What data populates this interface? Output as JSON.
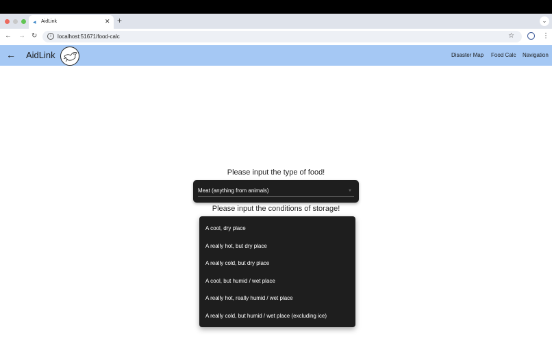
{
  "browser": {
    "tab_title": "AidLink",
    "tab_close": "✕",
    "new_tab": "+",
    "url": "localhost:51671/food-calc"
  },
  "appbar": {
    "title": "AidLink",
    "nav": [
      "Disaster Map",
      "Food Calc",
      "Navigation"
    ]
  },
  "form": {
    "food_prompt": "Please input the type of food!",
    "food_selected": "Meat (anything from animals)",
    "storage_prompt": "Please input the conditions of storage!",
    "storage_options": [
      "A cool, dry place",
      "A really hot, but dry place",
      "A really cold, but dry place",
      "A cool, but humid / wet place",
      "A really hot, really humid / wet place",
      "A really cold, but humid / wet place (excluding ice)"
    ]
  },
  "colors": {
    "appbar": "#a5c8f4",
    "dropdown_bg": "#1e1e1e"
  }
}
